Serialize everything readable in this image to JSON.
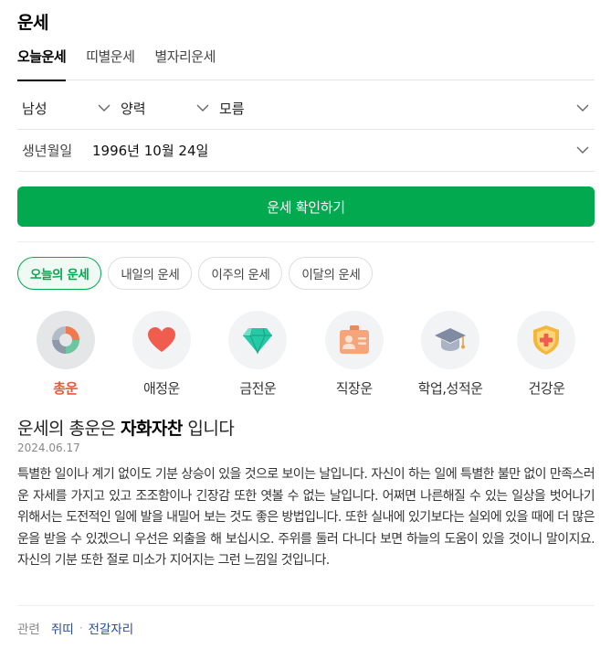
{
  "header": {
    "title": "운세"
  },
  "tabs": [
    {
      "label": "오늘운세",
      "active": true
    },
    {
      "label": "띠별운세",
      "active": false
    },
    {
      "label": "별자리운세",
      "active": false
    }
  ],
  "form": {
    "gender": "남성",
    "calendar": "양력",
    "birth_time": "모름",
    "birth_label": "생년월일",
    "birth_date": "1996년 10월 24일",
    "confirm_label": "운세 확인하기"
  },
  "period_chips": [
    {
      "label": "오늘의 운세",
      "active": true
    },
    {
      "label": "내일의 운세",
      "active": false
    },
    {
      "label": "이주의 운세",
      "active": false
    },
    {
      "label": "이달의 운세",
      "active": false
    }
  ],
  "categories": [
    {
      "label": "총운",
      "icon": "donut-chart-icon",
      "active": true
    },
    {
      "label": "애정운",
      "icon": "heart-icon",
      "active": false
    },
    {
      "label": "금전운",
      "icon": "diamond-icon",
      "active": false
    },
    {
      "label": "직장운",
      "icon": "id-card-icon",
      "active": false
    },
    {
      "label": "학업,성적운",
      "icon": "graduation-cap-icon",
      "active": false
    },
    {
      "label": "건강운",
      "icon": "health-shield-icon",
      "active": false
    }
  ],
  "result": {
    "title_prefix": "운세의 총운은 ",
    "title_keyword": "자화자찬",
    "title_suffix": " 입니다",
    "date": "2024.06.17",
    "body": "특별한 일이나 계기 없이도 기분 상승이 있을 것으로 보이는 날입니다. 자신이 하는 일에 특별한 불만 없이 만족스러운 자세를 가지고 있고 조조함이나 긴장감 또한 엿볼 수 없는 날입니다. 어쩌면 나른해질 수 있는 일상을 벗어나기 위해서는 도전적인 일에 발을 내밀어 보는 것도 좋은 방법입니다. 또한 실내에 있기보다는 실외에 있을 때에 더 많은 운을 받을 수 있겠으니 우선은 외출을 해 보십시오. 주위를 둘러 다니다 보면 하늘의 도움이 있을 것이니 말이지요. 자신의 기분 또한 절로 미소가 지어지는 그런 느낌일 것입니다."
  },
  "related": {
    "label": "관련",
    "links": [
      "쥐띠",
      "전갈자리"
    ],
    "separator": "·"
  },
  "colors": {
    "accent": "#03a94e",
    "active_category": "#e55a3c",
    "link": "#2a4d8f"
  }
}
